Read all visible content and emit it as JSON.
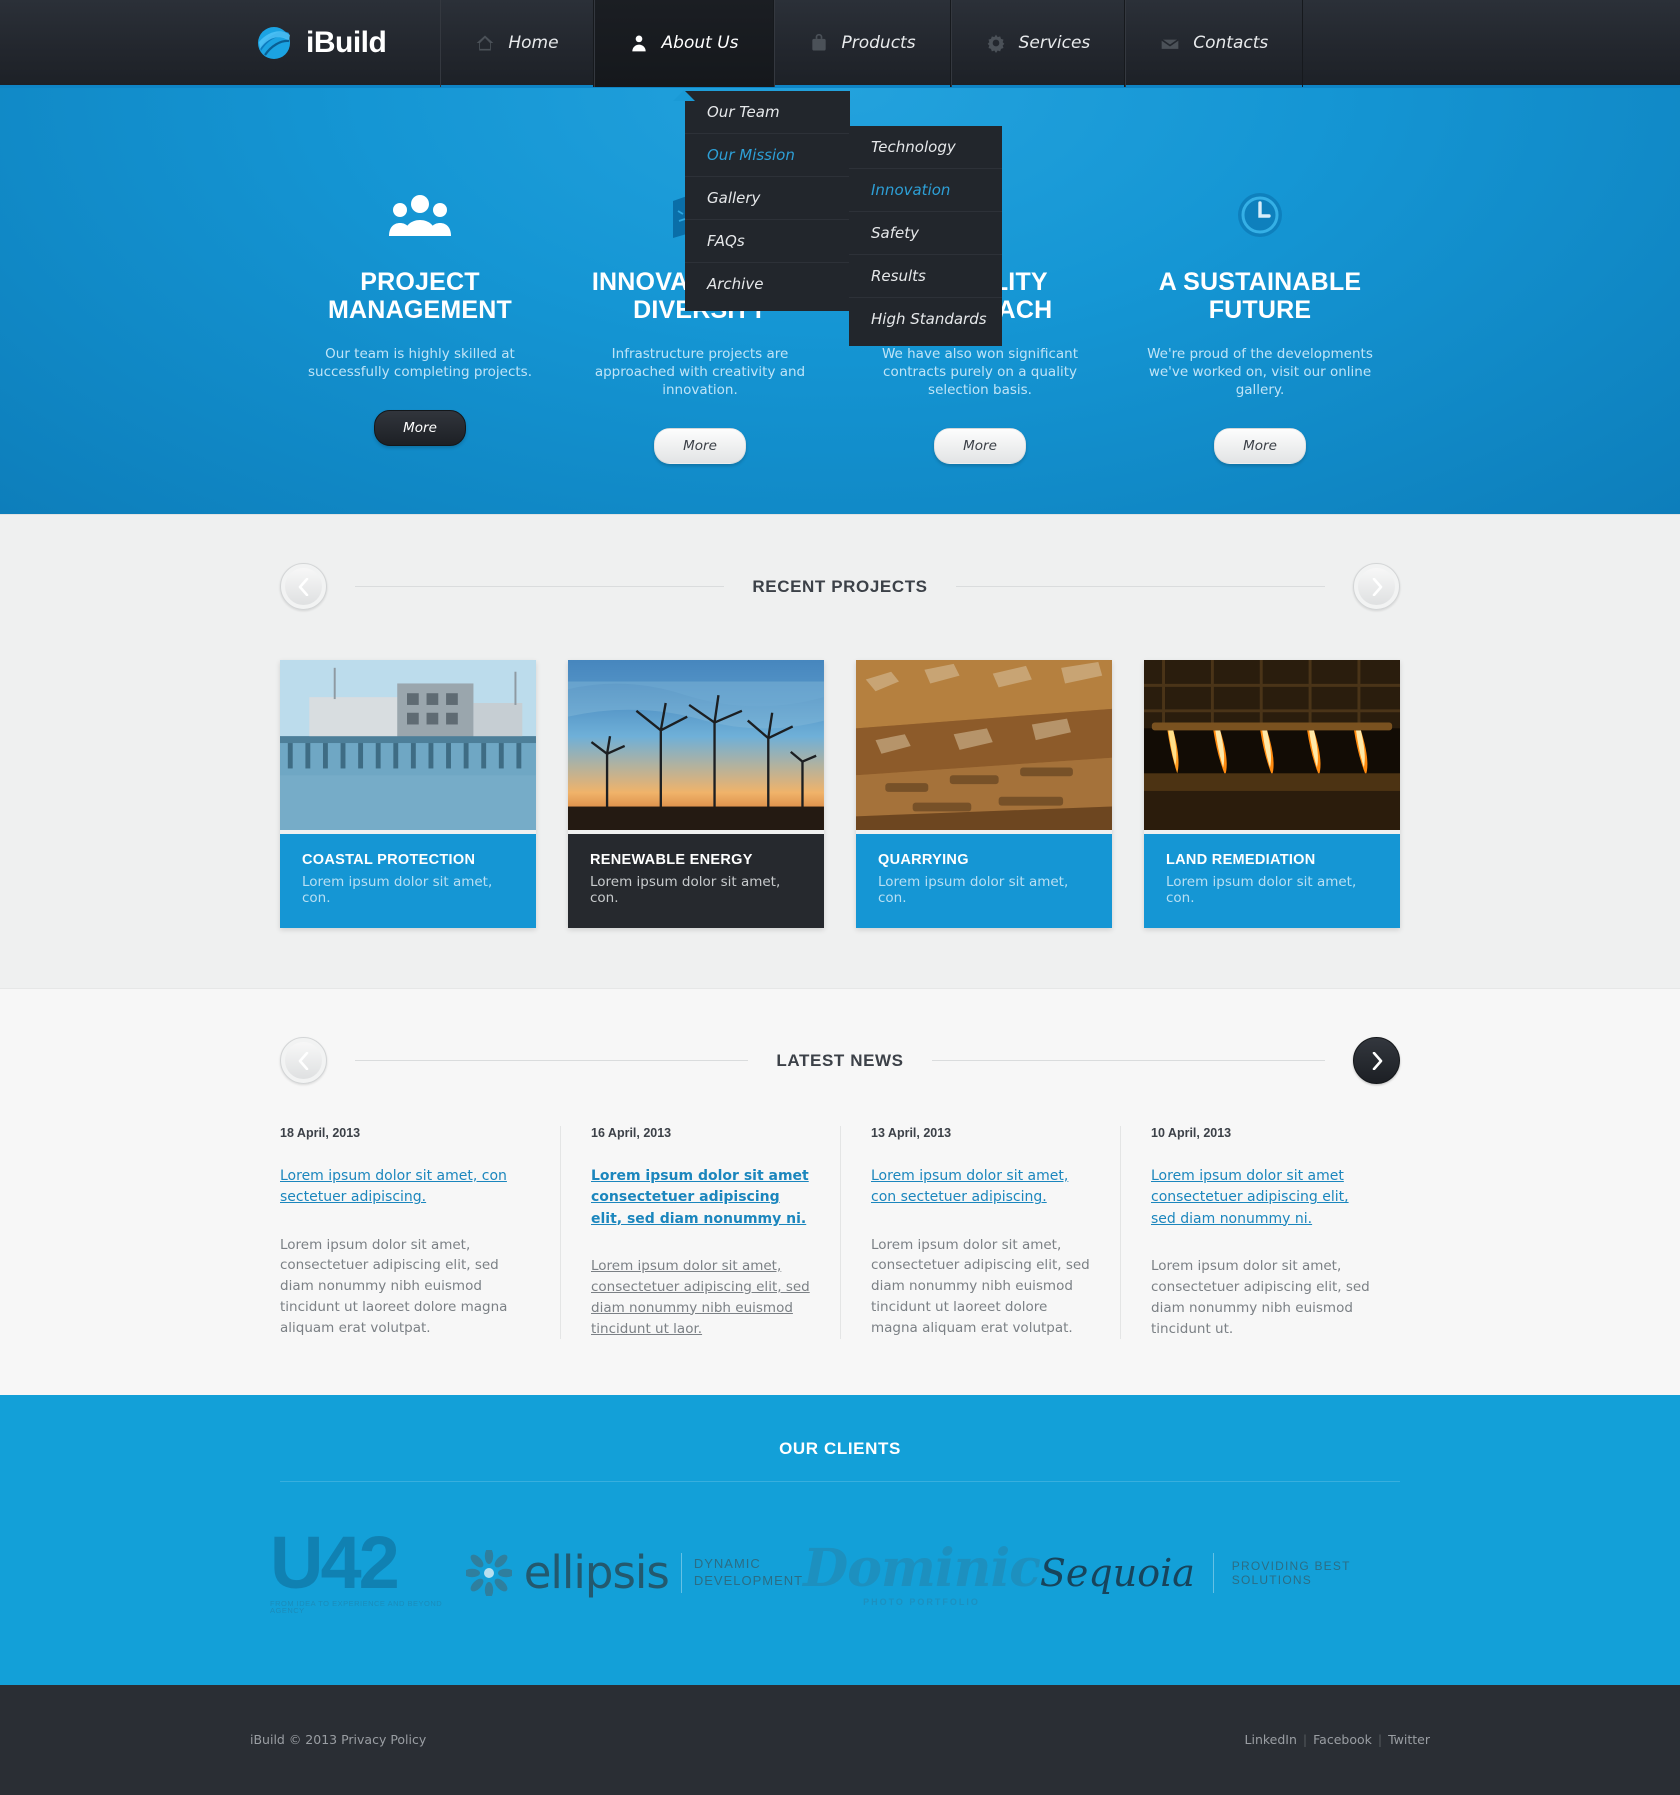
{
  "site": {
    "logo_text": "iBuild",
    "logo_icon": "swoosh-globe-icon"
  },
  "nav": {
    "items": [
      {
        "label": "Home",
        "icon": "home-icon",
        "active": false
      },
      {
        "label": "About Us",
        "icon": "user-icon",
        "active": true
      },
      {
        "label": "Products",
        "icon": "box-icon",
        "active": false
      },
      {
        "label": "Services",
        "icon": "gear-icon",
        "active": false
      },
      {
        "label": "Contacts",
        "icon": "mail-icon",
        "active": false
      }
    ]
  },
  "dropdown": {
    "items": [
      {
        "label": "Our Team",
        "highlighted": false
      },
      {
        "label": "Our Mission",
        "highlighted": true
      },
      {
        "label": "Gallery",
        "highlighted": false
      },
      {
        "label": "FAQs",
        "highlighted": false
      },
      {
        "label": "Archive",
        "highlighted": false
      }
    ]
  },
  "submenu": {
    "items": [
      {
        "label": "Technology",
        "highlighted": false
      },
      {
        "label": "Innovation",
        "highlighted": true
      },
      {
        "label": "Safety",
        "highlighted": false
      },
      {
        "label": "Results",
        "highlighted": false
      },
      {
        "label": "High Standards",
        "highlighted": false
      }
    ]
  },
  "hero": {
    "columns": [
      {
        "icon": "people-group-icon",
        "title": "PROJECT MANAGEMENT",
        "text": "Our team is highly skilled at successfully completing projects.",
        "button": "More",
        "button_style": "dark"
      },
      {
        "icon": "map-icon",
        "title": "INNOVATION AND DIVERSITY",
        "text": "Infrastructure projects are approached with creativity and innovation.",
        "button": "More",
        "button_style": "light"
      },
      {
        "icon": "quality-icon",
        "title": "A QUALITY APPROACH",
        "text": "We have also won significant contracts purely on a quality selection basis.",
        "button": "More",
        "button_style": "light"
      },
      {
        "icon": "clock-icon",
        "title": "A SUSTAINABLE FUTURE",
        "text": "We're proud of the developments we've worked on, visit our online gallery.",
        "button": "More",
        "button_style": "light"
      }
    ]
  },
  "projects": {
    "title": "RECENT PROJECTS",
    "prev_icon": "chevron-left-icon",
    "next_icon": "chevron-right-icon",
    "cards": [
      {
        "title": "COASTAL PROTECTION",
        "desc": "Lorem ipsum dolor sit amet, con.",
        "style": "blue",
        "art": "harbour"
      },
      {
        "title": "RENEWABLE ENERGY",
        "desc": "Lorem ipsum dolor sit amet, con.",
        "style": "dark",
        "art": "windfarm"
      },
      {
        "title": "QUARRYING",
        "desc": "Lorem ipsum dolor sit amet, con.",
        "style": "blue",
        "art": "quarry"
      },
      {
        "title": "LAND REMEDIATION",
        "desc": "Lorem ipsum dolor sit amet, con.",
        "style": "blue",
        "art": "steel"
      }
    ]
  },
  "news": {
    "title": "LATEST NEWS",
    "prev_icon": "chevron-left-icon",
    "next_icon": "chevron-right-icon",
    "items": [
      {
        "date": "18 April, 2013",
        "link": "Lorem ipsum dolor sit amet, con sectetuer adipiscing.",
        "bold": false,
        "body": "Lorem ipsum dolor sit amet, consectetuer adipiscing elit, sed diam nonummy nibh euismod tincidunt ut laoreet dolore magna aliquam erat volutpat.",
        "body_underline": false
      },
      {
        "date": "16 April, 2013",
        "link": "Lorem ipsum dolor sit amet consectetuer adipiscing elit, sed diam nonummy ni.",
        "bold": true,
        "body": "Lorem ipsum dolor sit amet, consectetuer adipiscing elit, sed diam nonummy nibh euismod tincidunt ut laor.",
        "body_underline": true
      },
      {
        "date": "13 April, 2013",
        "link": "Lorem ipsum dolor sit amet, con sectetuer adipiscing.",
        "bold": false,
        "body": "Lorem ipsum dolor sit amet, consectetuer adipiscing elit, sed diam nonummy nibh euismod tincidunt ut laoreet dolore magna aliquam erat volutpat.",
        "body_underline": false
      },
      {
        "date": "10 April, 2013",
        "link": "Lorem ipsum dolor sit amet consectetuer adipiscing elit, sed diam nonummy ni.",
        "bold": false,
        "body": "Lorem ipsum dolor sit amet, consectetuer adipiscing elit, sed diam nonummy nibh euismod tincidunt ut.",
        "body_underline": false
      }
    ]
  },
  "clients": {
    "title": "OUR CLIENTS",
    "logos": [
      {
        "name": "U42",
        "sub": "FROM IDEA TO EXPERIENCE AND BEYOND AGENCY"
      },
      {
        "name": "ellipsis",
        "tag_line_1": "DYNAMIC",
        "tag_line_2": "DEVELOPMENT"
      },
      {
        "name": "Dominic",
        "sub": "PHOTO PORTFOLIO"
      },
      {
        "name": "Sequoia",
        "tag": "PROVIDING BEST SOLUTIONS"
      }
    ]
  },
  "footer": {
    "copyright": "iBuild © 2013 Privacy Policy",
    "links": [
      "LinkedIn",
      "Facebook",
      "Twitter"
    ],
    "separator": "|"
  },
  "colors": {
    "brand_blue": "#1596d4",
    "clients_blue": "#13a0d8",
    "dark": "#23272e",
    "link_blue": "#1b86bd"
  }
}
